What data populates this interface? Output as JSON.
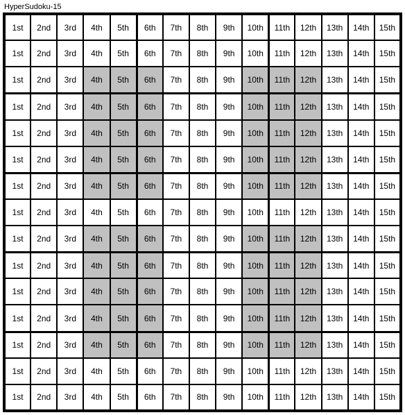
{
  "title": "HyperSudoku-15",
  "grid": {
    "rows": 15,
    "cols": 15,
    "region_rows": 3,
    "region_cols": 5,
    "column_labels": [
      "1st",
      "2nd",
      "3rd",
      "4th",
      "5th",
      "6th",
      "7th",
      "8th",
      "9th",
      "10th",
      "11th",
      "12th",
      "13th",
      "14th",
      "15th"
    ],
    "shaded_regions": [
      {
        "row_start": 2,
        "row_end": 6,
        "col_start": 3,
        "col_end": 5
      },
      {
        "row_start": 2,
        "row_end": 6,
        "col_start": 9,
        "col_end": 11
      },
      {
        "row_start": 8,
        "row_end": 12,
        "col_start": 3,
        "col_end": 5
      },
      {
        "row_start": 8,
        "row_end": 12,
        "col_start": 9,
        "col_end": 11
      }
    ],
    "shaded_gap_row": 7
  }
}
